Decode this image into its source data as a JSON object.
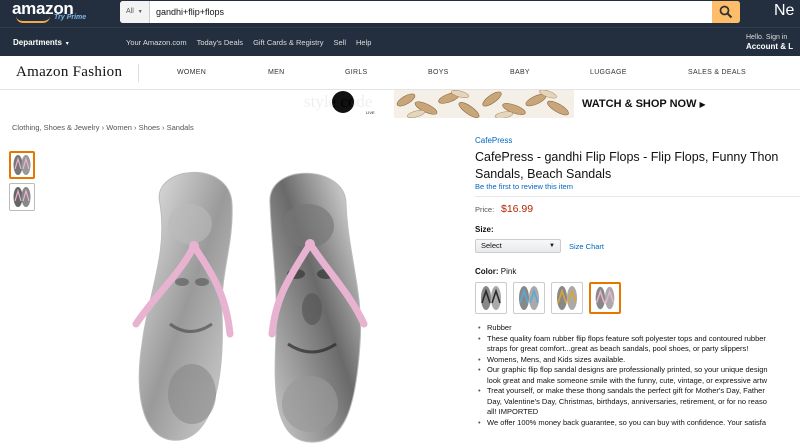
{
  "header": {
    "logo_text": "amazon",
    "logo_sub": "Try Prime",
    "search_category": "All",
    "search_query": "gandhi+flip+flops",
    "right_text": "Ne"
  },
  "nav": {
    "departments": "Departments",
    "links": [
      "Your Amazon.com",
      "Today's Deals",
      "Gift Cards & Registry",
      "Sell",
      "Help"
    ],
    "account_line1": "Hello. Sign in",
    "account_line2": "Account & L"
  },
  "fashion": {
    "logo": "Amazon Fashion",
    "categories": [
      "WOMEN",
      "MEN",
      "GIRLS",
      "BOYS",
      "BABY",
      "LUGGAGE",
      "SALES & DEALS"
    ]
  },
  "banner": {
    "brand": "style code",
    "brand_sub": "LIVE",
    "cta": "WATCH & SHOP NOW"
  },
  "breadcrumb": [
    "Clothing, Shoes & Jewelry",
    "Women",
    "Shoes",
    "Sandals"
  ],
  "product": {
    "brand": "CafePress",
    "title_line1": "CafePress - gandhi Flip Flops - Flip Flops, Funny Thon",
    "title_line2": "Sandals, Beach Sandals",
    "review_link": "Be the first to review this item",
    "price_label": "Price:",
    "price": "$16.99",
    "size_label": "Size:",
    "size_value": "Select",
    "size_chart": "Size Chart",
    "color_label": "Color:",
    "color_value": "Pink",
    "swatch_colors": [
      "#2b2b2b",
      "#5aa9d6",
      "#d8a535",
      "#e8b3d0"
    ],
    "bullets": [
      "Rubber",
      "These quality foam rubber flip flops feature soft polyester tops and contoured rubber",
      "straps for great comfort...great as beach sandals, pool shoes, or party slippers!",
      "Womens, Mens, and Kids sizes available.",
      "Our graphic flip flop sandal designs are professionally printed, so your unique design",
      "look great and make someone smile with the funny, cute, vintage, or expressive artw",
      "Treat yourself, or make these thong sandals the perfect gift for Mother's Day, Father",
      "Day, Valentine's Day, Christmas, birthdays, anniversaries, retirement, or for no reaso",
      "all! IMPORTED",
      "We offer 100% money back guarantee, so you can buy with confidence. Your satisfa"
    ]
  },
  "colors": {
    "header_bg": "#232f3e",
    "search_button": "#febd69",
    "link": "#0066c0",
    "price": "#b12704",
    "selected_border": "#e77600",
    "strap": "#e8b3d0"
  }
}
